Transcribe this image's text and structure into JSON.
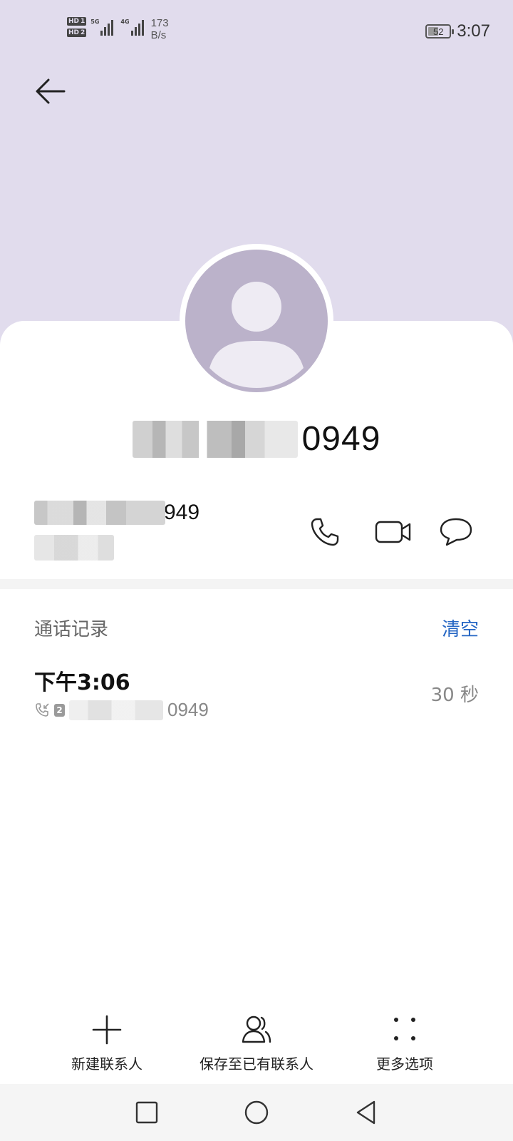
{
  "status_bar": {
    "sim1_label": "HD",
    "sim1_index": "1",
    "sim2_label": "HD",
    "sim2_index": "2",
    "net1": "5G",
    "net2": "4G",
    "speed_value": "173",
    "speed_unit": "B/s",
    "battery": "52",
    "time": "3:07"
  },
  "contact": {
    "name_suffix": "0949",
    "number_suffix": "949"
  },
  "call_log": {
    "title": "通话记录",
    "clear_label": "清空",
    "entries": [
      {
        "time": "下午3:06",
        "sim": "2",
        "number_suffix": "0949",
        "duration": "30 秒"
      }
    ]
  },
  "bottom_actions": {
    "new_contact": "新建联系人",
    "save_existing": "保存至已有联系人",
    "more_options": "更多选项"
  },
  "colors": {
    "header_bg": "#e1dced",
    "avatar_bg": "#bbb2ca",
    "accent": "#2566c4"
  }
}
